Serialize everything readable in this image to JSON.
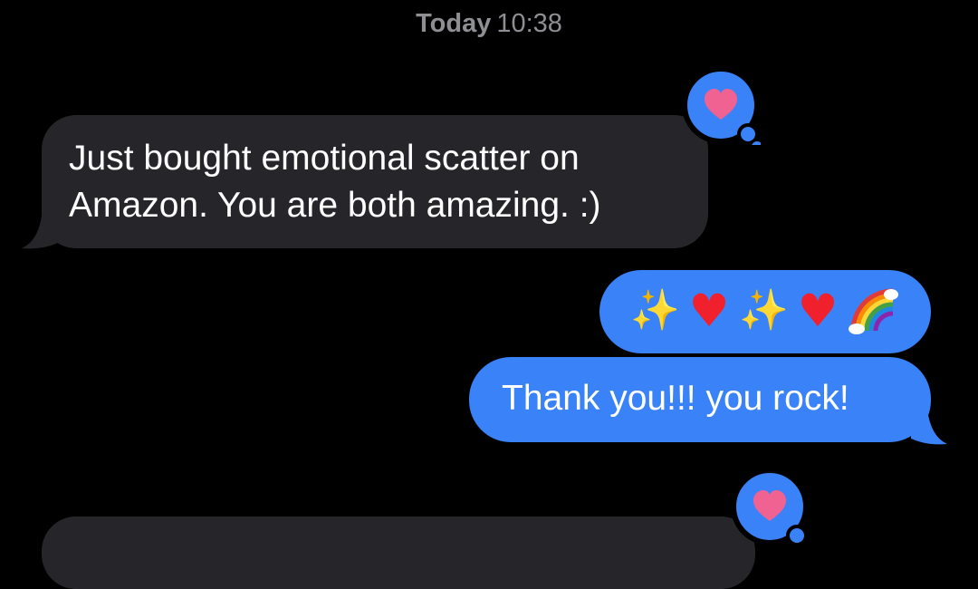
{
  "header": {
    "day_label": "Today",
    "time_label": "10:38"
  },
  "messages": [
    {
      "direction": "incoming",
      "lines": [
        "Just bought emotional scatter on",
        "Amazon. You are both amazing. :)"
      ],
      "reaction": "heart"
    },
    {
      "direction": "outgoing",
      "emoji": [
        "sparkles",
        "red-heart",
        "sparkles",
        "red-heart",
        "rainbow"
      ]
    },
    {
      "direction": "outgoing",
      "text": "Thank you!!! you rock!"
    },
    {
      "direction": "incoming",
      "text": "",
      "reaction": "heart"
    }
  ],
  "colors": {
    "background": "#000000",
    "incoming_bubble": "#26262a",
    "outgoing_bubble": "#3a82f7",
    "timestamp": "#8e8e93",
    "reaction_heart": "#f06292"
  },
  "glyphs": {
    "sparkles": "✨",
    "red_heart": "♥"
  }
}
